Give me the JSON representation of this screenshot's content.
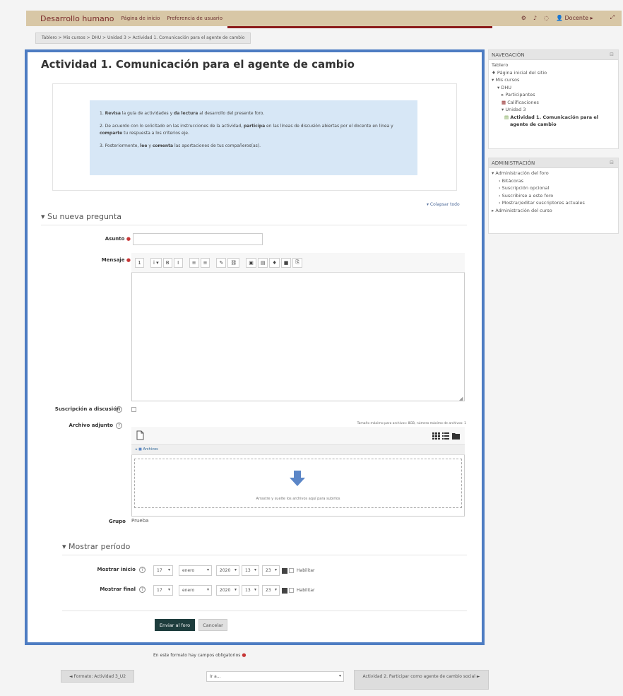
{
  "header": {
    "brand": "Desarrollo humano",
    "links": [
      "Página de inicio",
      "Preferencia de usuario"
    ],
    "user_label": "Docente"
  },
  "breadcrumb": "Tablero > Mis cursos > DHU > Unidad 3 > Actividad 1. Comunicación para el agente de cambio",
  "page_title": "Actividad 1. Comunicación para el agente de cambio",
  "intro": {
    "p1_pre": "1. ",
    "p1_b1": "Revisa",
    "p1_mid": " la guía de actividades y ",
    "p1_b2": "da lectura",
    "p1_post": " al desarrollo del presente foro.",
    "p2_pre": "2. De acuerdo con lo solicitado en las instrucciones de la actividad, ",
    "p2_b1": "participa",
    "p2_mid": " en las líneas de discusión abiertas por el docente en línea y ",
    "p2_b2": "comparte",
    "p2_post": " tu respuesta a los criterios eje.",
    "p3_pre": "3. Posteriormente, ",
    "p3_b1": "lee",
    "p3_mid": " y ",
    "p3_b2": "comenta",
    "p3_post": " las aportaciones de tus compañeros(as)."
  },
  "collapse_all": "Colapsar todo",
  "section_question": "Su nueva pregunta",
  "form": {
    "asunto_label": "Asunto",
    "mensaje_label": "Mensaje",
    "suscripcion_label": "Suscripción a discusión",
    "archivo_label": "Archivo adjunto",
    "file_limits": "Tamaño máximo para archivos: 8GB, número máximo de archivos: 1",
    "files_path": "Archivos",
    "drop_text": "Arrastre y suelte los archivos aquí para subirlos",
    "grupo_label": "Grupo",
    "grupo_value": "Prueba"
  },
  "toolbar_buttons": [
    "1",
    "i ▾",
    "B",
    "I",
    "≡",
    "≡",
    "✎",
    "⛓",
    "▣",
    "▤",
    "♦",
    "■",
    "⎘"
  ],
  "section_period": "Mostrar período",
  "period": {
    "start_label": "Mostrar inicio",
    "end_label": "Mostrar final",
    "day": "17",
    "month": "enero",
    "year": "2020",
    "hour": "13",
    "minute": "23",
    "enable": "Habilitar"
  },
  "buttons": {
    "submit": "Enviar al foro",
    "cancel": "Cancelar"
  },
  "required_note": "En este formato hay campos obligatorios",
  "bottom_nav": {
    "prev": "◄ Formato: Actividad 3_U2",
    "jump": "Ir a...",
    "next": "Actividad 2. Participar como agente de cambio social ►"
  },
  "navigation": {
    "title": "NAVEGACIÓN",
    "items": [
      "Tablero",
      "Página inicial del sitio",
      "Mis cursos",
      "DHU",
      "Participantes",
      "Calificaciones",
      "Unidad 3",
      "Actividad 1. Comunicación para el agente de cambio"
    ]
  },
  "administration": {
    "title": "ADMINISTRACIÓN",
    "items": [
      "Administración del foro",
      "Bitácoras",
      "Suscripción opcional",
      "Suscribirse a este foro",
      "Mostrar/editar suscriptores actuales",
      "Administración del curso"
    ]
  },
  "colors": {
    "navbar": "#d8c7a6",
    "brand": "#7a2b2b",
    "focus_border": "#4d7cc2",
    "intro_bg": "#d7e7f6",
    "submit_bg": "#1e3d3d",
    "drop_arrow": "#5b86c7"
  }
}
